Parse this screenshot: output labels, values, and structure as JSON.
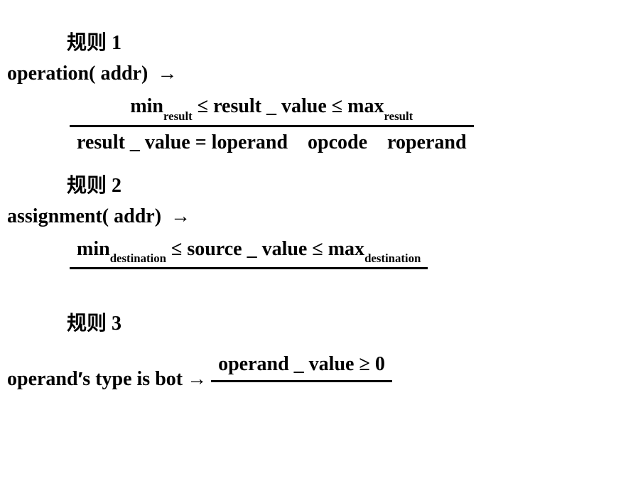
{
  "rule1": {
    "header_cjk": "规则",
    "header_num": "1",
    "premise_func": "operation",
    "premise_arg": "addr",
    "arrow": "→",
    "numerator": {
      "min_word": "min",
      "min_sub": "result",
      "leq1": "≤",
      "mid": "result _ value",
      "leq2": "≤",
      "max_word": "max",
      "max_sub": "result"
    },
    "denominator": {
      "lhs": "result _ value",
      "eq": "=",
      "loperand": "loperand",
      "opcode": "opcode",
      "roperand": "roperand"
    }
  },
  "rule2": {
    "header_cjk": "规则",
    "header_num": "2",
    "premise_func": "assignment",
    "premise_arg": "addr",
    "arrow": "→",
    "numerator": {
      "min_word": "min",
      "min_sub": "destination",
      "leq1": "≤",
      "mid": "source _ value",
      "leq2": "≤",
      "max_word": "max",
      "max_sub": "destination"
    }
  },
  "rule3": {
    "header_cjk": "规则",
    "header_num": "3",
    "premise_operand": "operand",
    "premise_prime": "′",
    "premise_rest": "s type is bot",
    "arrow": "→",
    "numerator": {
      "left": "operand _ value",
      "geq": "≥",
      "right": "0"
    }
  }
}
